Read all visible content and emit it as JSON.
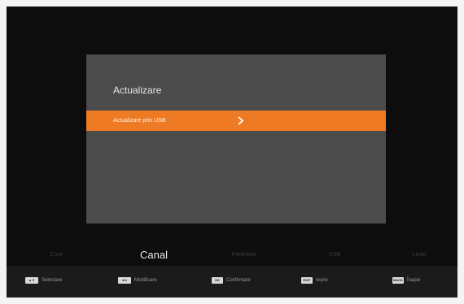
{
  "dialog": {
    "title": "Actualizare",
    "items": [
      {
        "label": "Actualizare prin USB",
        "selected": true
      }
    ]
  },
  "tabs": [
    {
      "label": "Cont",
      "active": false
    },
    {
      "label": "Canal",
      "active": true
    },
    {
      "label": "Preferinţe",
      "active": false
    },
    {
      "label": "USB",
      "active": false
    },
    {
      "label": "Limbi",
      "active": false
    }
  ],
  "hints": [
    {
      "key": "▲▼",
      "icon": "up-down-keys-icon",
      "label": "Selectare"
    },
    {
      "key": "◄►",
      "icon": "left-right-keys-icon",
      "label": "Modificare"
    },
    {
      "key": "OK",
      "icon": "ok-key-icon",
      "label": "Confirmare"
    },
    {
      "key": "EXIT",
      "icon": "exit-key-icon",
      "label": "Ieşire"
    },
    {
      "key": "BACK",
      "icon": "back-key-icon",
      "label": "Înapoi"
    }
  ],
  "colors": {
    "accent": "#ef7a24",
    "dialog_bg": "#4b4b4b",
    "screen_bg": "#0d0d0d",
    "hint_bar_bg": "#1b1b1b"
  }
}
